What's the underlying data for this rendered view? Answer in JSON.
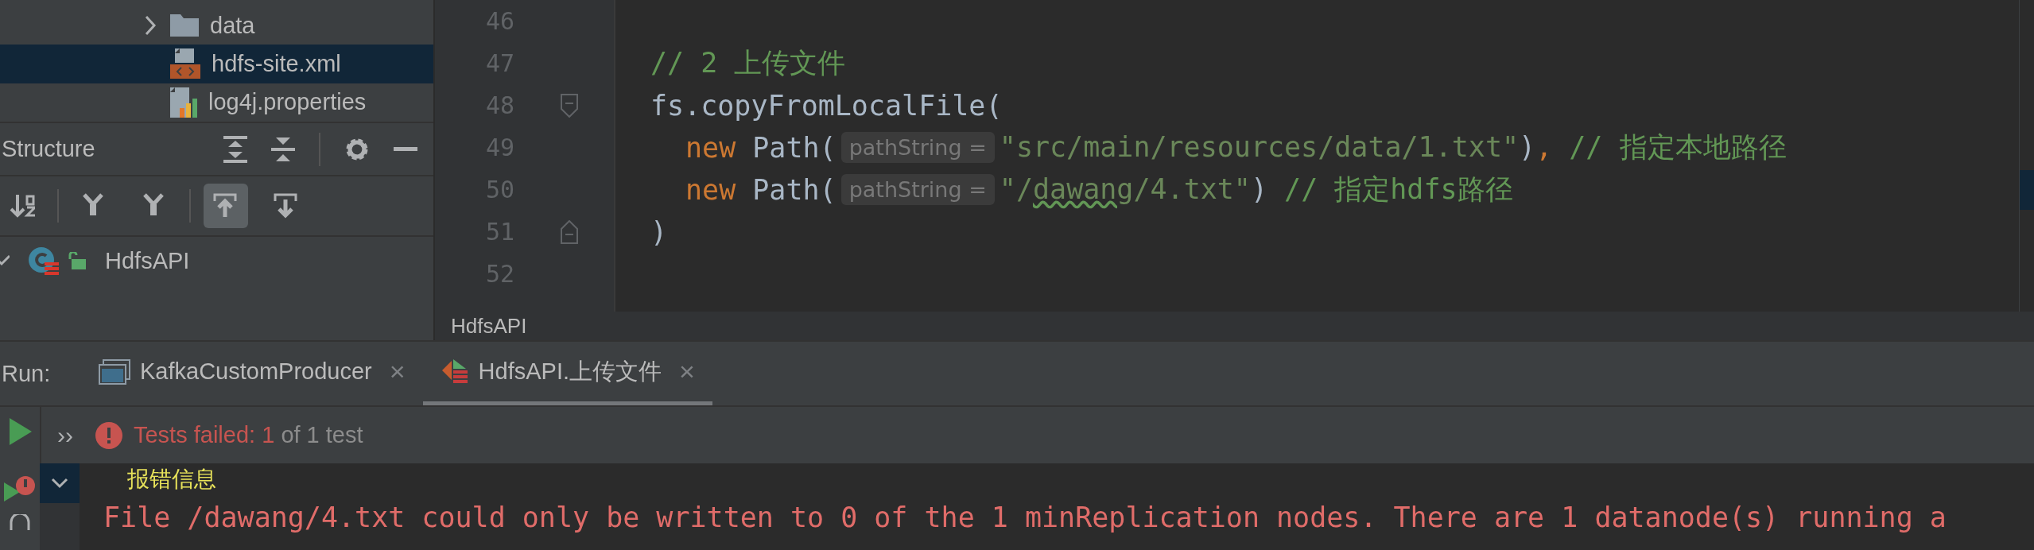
{
  "project_tree": [
    {
      "label": "data",
      "kind": "folder",
      "expanded": false,
      "selected": false
    },
    {
      "label": "hdfs-site.xml",
      "kind": "xml",
      "selected": true
    },
    {
      "label": "log4j.properties",
      "kind": "properties",
      "selected": false
    }
  ],
  "structure": {
    "title": "Structure",
    "toolbar": [
      [
        {
          "kind": "sort-alpha",
          "selected": false
        }
      ],
      [
        {
          "kind": "filter",
          "selected": false
        },
        {
          "kind": "filter",
          "selected": false
        }
      ],
      [
        {
          "kind": "scroll-up",
          "selected": true
        },
        {
          "kind": "scroll-down",
          "selected": false
        }
      ]
    ],
    "items": [
      {
        "label": "HdfsAPI",
        "expanded": true
      }
    ]
  },
  "editor": {
    "lines": [
      {
        "number": "46"
      },
      {
        "number": "47",
        "segments": [
          {
            "kind": "code",
            "spans": [
              {
                "kind": "comment",
                "text": "// 2 上传文件"
              }
            ]
          }
        ]
      },
      {
        "number": "48",
        "fold_start": true,
        "segments": [
          {
            "kind": "code",
            "spans": [
              {
                "kind": "plain",
                "text": "fs.copyFromLocalFile("
              }
            ]
          }
        ],
        "children": [
          {
            "number": "49",
            "segments": [
              {
                "kind": "code",
                "spans": [
                  {
                    "kind": "keyword",
                    "text": "new"
                  },
                  {
                    "kind": "plain",
                    "text": " Path("
                  }
                ]
              },
              {
                "kind": "hint",
                "text": "pathString ="
              },
              {
                "kind": "code",
                "spans": [
                  {
                    "kind": "string",
                    "text": "\"src/main/resources/data/1.txt\""
                  },
                  {
                    "kind": "plain",
                    "text": ")"
                  },
                  {
                    "kind": "keyword",
                    "text": ","
                  },
                  {
                    "kind": "comment",
                    "text": " // 指定本地路径"
                  }
                ]
              }
            ]
          },
          {
            "number": "50",
            "segments": [
              {
                "kind": "code",
                "spans": [
                  {
                    "kind": "keyword",
                    "text": "new"
                  },
                  {
                    "kind": "plain",
                    "text": " Path("
                  }
                ]
              },
              {
                "kind": "hint",
                "text": "pathString ="
              },
              {
                "kind": "code",
                "spans": [
                  {
                    "kind": "string",
                    "text": "\"/"
                  },
                  {
                    "kind": "typo",
                    "text": "dawang"
                  },
                  {
                    "kind": "string",
                    "text": "/4.txt\""
                  },
                  {
                    "kind": "plain",
                    "text": ")"
                  },
                  {
                    "kind": "comment",
                    "text": " // 指定hdfs路径"
                  }
                ]
              }
            ]
          }
        ]
      },
      {
        "number": "51",
        "fold_end": true,
        "segments": [
          {
            "kind": "code",
            "spans": [
              {
                "kind": "plain",
                "text": ")"
              }
            ]
          }
        ]
      },
      {
        "number": "52"
      }
    ],
    "breadcrumb": "HdfsAPI"
  },
  "run": {
    "label": "Run:",
    "tabs": [
      {
        "label": "KafkaCustomProducer",
        "kind": "console",
        "selected": false,
        "close": "×"
      },
      {
        "label": "HdfsAPI.上传文件",
        "kind": "test",
        "selected": true,
        "close": "×"
      }
    ]
  },
  "tests": {
    "expand": "››",
    "failed": true,
    "summary": "Tests failed: 1",
    "detail": "of 1 test"
  },
  "console": {
    "lines": [
      {
        "kind": "info",
        "text": "报错信息"
      },
      {
        "kind": "error",
        "text": "File /dawang/4.txt could only be written to 0 of the 1 minReplication nodes. There are 1 datanode(s) running a"
      }
    ]
  }
}
